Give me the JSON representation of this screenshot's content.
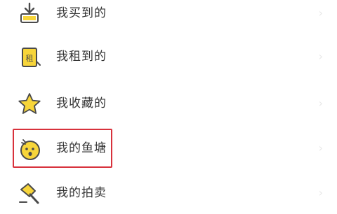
{
  "menu": {
    "items": [
      {
        "label": "我买到的",
        "icon": "bought-download-icon"
      },
      {
        "label": "我租到的",
        "icon": "rent-tag-icon",
        "icon_text": "租"
      },
      {
        "label": "我收藏的",
        "icon": "star-icon"
      },
      {
        "label": "我的鱼塘",
        "icon": "fishpond-face-icon"
      },
      {
        "label": "我的拍卖",
        "icon": "auction-hammer-icon"
      }
    ],
    "chevron": "›"
  },
  "colors": {
    "highlight_border": "#d8323c",
    "icon_yellow": "#f7d53a",
    "icon_outline": "#4a4a4a"
  }
}
